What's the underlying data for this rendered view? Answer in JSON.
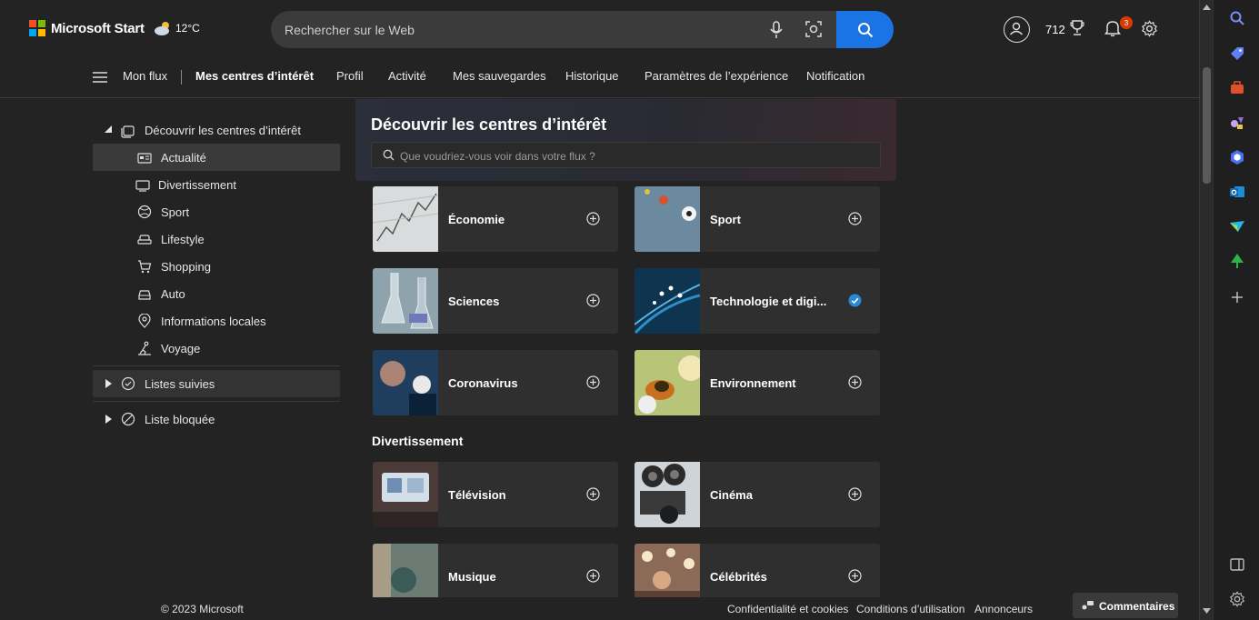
{
  "header": {
    "logo_text": "Microsoft Start",
    "weather_temp": "12°C",
    "search_placeholder": "Rechercher sur le Web",
    "points": "712",
    "notification_count": "3"
  },
  "nav": {
    "items": [
      "Mon flux",
      "Mes centres d’intérêt",
      "Profil",
      "Activité",
      "Mes sauvegardes",
      "Historique",
      "Paramètres de l’expérience",
      "Notification"
    ],
    "active": "Mes centres d’intérêt"
  },
  "sidebar": {
    "discover_label": "Découvrir les centres d’intérêt",
    "subitems": [
      "Actualité",
      "Divertissement",
      "Sport",
      "Lifestyle",
      "Shopping",
      "Auto",
      "Informations locales",
      "Voyage"
    ],
    "selected": "Actualité",
    "followed_label": "Listes suivies",
    "blocked_label": "Liste bloquée"
  },
  "main": {
    "title": "Découvrir les centres d’intérêt",
    "search_placeholder": "Que voudriez-vous voir dans votre flux ?",
    "cards_news": [
      {
        "name": "Économie",
        "followed": false
      },
      {
        "name": "Sport",
        "followed": false
      },
      {
        "name": "Sciences",
        "followed": false
      },
      {
        "name": "Technologie et digi...",
        "followed": true
      },
      {
        "name": "Coronavirus",
        "followed": false
      },
      {
        "name": "Environnement",
        "followed": false
      }
    ],
    "section_entertainment": "Divertissement",
    "cards_entertainment": [
      {
        "name": "Télévision",
        "followed": false
      },
      {
        "name": "Cinéma",
        "followed": false
      },
      {
        "name": "Musique",
        "followed": false
      },
      {
        "name": "Célébrités",
        "followed": false
      }
    ]
  },
  "footer": {
    "copyright": "© 2023 Microsoft",
    "links": [
      "Confidentialité et cookies",
      "Conditions d’utilisation",
      "Annonceurs"
    ],
    "feedback_label": "Commentaires"
  },
  "colors": {
    "accent": "#1b74e4",
    "background": "#232323",
    "card": "#2f2f2f",
    "badge": "#d83b01"
  }
}
